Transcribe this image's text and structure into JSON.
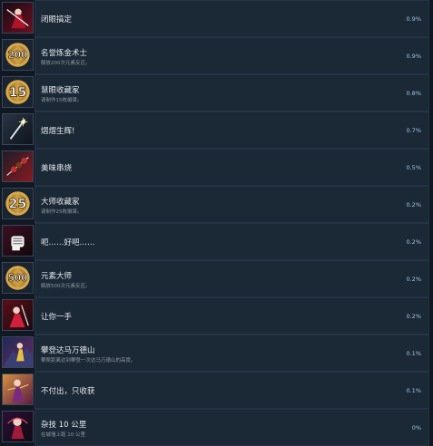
{
  "colors": {
    "background": "#0f1823",
    "row_bg": "#1b2836",
    "title": "#e6e9ec",
    "description": "#8f98a3",
    "percent": "#9fc7ea"
  },
  "achievements": [
    {
      "title": "闭眼搞定",
      "description": "",
      "percent": "0.9%",
      "icon": "crimson-swordsman-icon",
      "badge": ""
    },
    {
      "title": "名誉炼金术士",
      "description": "解放200次元素反应。",
      "percent": "0.9%",
      "icon": "number-badge-icon",
      "badge": "200"
    },
    {
      "title": "慧眼收藏家",
      "description": "请制作15枚徽章。",
      "percent": "0.8%",
      "icon": "number-badge-icon",
      "badge": "15"
    },
    {
      "title": "熠熠生辉!",
      "description": "",
      "percent": "0.7%",
      "icon": "sparkling-sword-icon",
      "badge": ""
    },
    {
      "title": "美味串烧",
      "description": "",
      "percent": "0.5%",
      "icon": "skewer-icon",
      "badge": ""
    },
    {
      "title": "大师收藏家",
      "description": "请制作25枚徽章。",
      "percent": "0.2%",
      "icon": "number-badge-icon",
      "badge": "25"
    },
    {
      "title": "呃……好吧……",
      "description": "",
      "percent": "0.2%",
      "icon": "fist-icon",
      "badge": ""
    },
    {
      "title": "元素大师",
      "description": "解放500次元素反应。",
      "percent": "0.2%",
      "icon": "number-badge-icon",
      "badge": "500"
    },
    {
      "title": "让你一手",
      "description": "",
      "percent": "0.2%",
      "icon": "crimson-warrior-icon",
      "badge": ""
    },
    {
      "title": "攀登达马万德山",
      "description": "攀爬距离达到攀登一次达马万德山的高度。",
      "percent": "0.1%",
      "icon": "mountain-climber-icon",
      "badge": ""
    },
    {
      "title": "不付出，只收获",
      "description": "",
      "percent": "0.1%",
      "icon": "dancer-icon",
      "badge": ""
    },
    {
      "title": "杂技 10 公里",
      "description": "在城墙上跑 10 公里",
      "percent": "0%",
      "icon": "acrobat-icon",
      "badge": ""
    }
  ]
}
